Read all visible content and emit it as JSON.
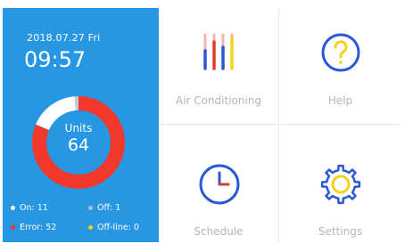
{
  "status_panel": {
    "date": "2018.07.27  Fri",
    "time": "09:57",
    "units_label": "Units",
    "units_total": "64",
    "units_breakdown": {
      "on": 11,
      "off": 1,
      "error": 52,
      "offline": 0
    },
    "legend": [
      {
        "label": "On: 11",
        "color": "#ffffff"
      },
      {
        "label": "Off: 1",
        "color": "#b8b8c8"
      },
      {
        "label": "Error: 52",
        "color": "#f2382a"
      },
      {
        "label": "Off-line: 0",
        "color": "#f3d21d"
      }
    ],
    "donut_colors": {
      "on": "#ffffff",
      "off": "#c9c9d4",
      "error": "#f2382a",
      "offline": "#f3d21d"
    }
  },
  "menu": [
    {
      "label": "Air Conditioning",
      "icon": "air-conditioning-icon"
    },
    {
      "label": "Help",
      "icon": "help-icon"
    },
    {
      "label": "Schedule",
      "icon": "clock-icon"
    },
    {
      "label": "Settings",
      "icon": "gear-icon"
    }
  ],
  "colors": {
    "panel": "#2796e3",
    "icon_blue": "#2b56d6",
    "icon_red": "#e03a2c",
    "icon_yellow": "#f3d21d",
    "label_gray": "#b5b5b5"
  }
}
